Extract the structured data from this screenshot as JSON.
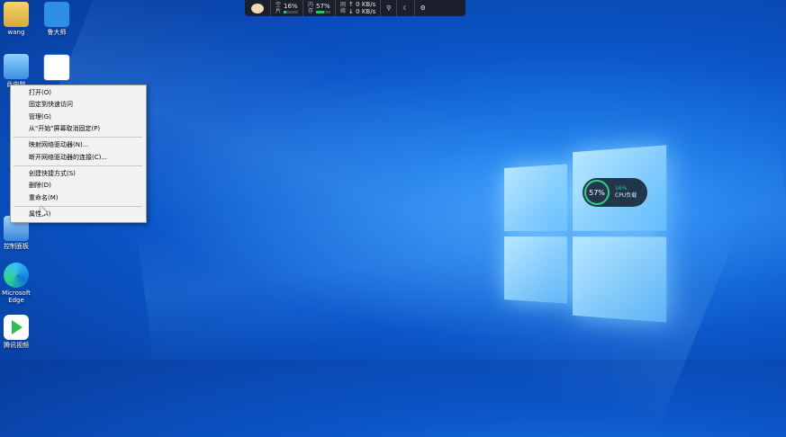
{
  "monitor": {
    "mem_key": "空",
    "mem_key2": "片",
    "mem_value": "16%",
    "cpu_key": "内",
    "cpu_key2": "存",
    "cpu_value": "57%",
    "net_key": "网",
    "net_key2": "络",
    "up_speed": "0 KB/s",
    "down_speed": "0 KB/s",
    "mem_fill": 0.16,
    "cpu_fill": 0.57
  },
  "desktop_icons": [
    {
      "label": "wang"
    },
    {
      "label": "鲁大师"
    },
    {
      "label": "此电脑"
    },
    {
      "label": "控制面板"
    },
    {
      "label": "Microsoft\nEdge"
    },
    {
      "label": "腾讯视频"
    }
  ],
  "context_menu": {
    "items": [
      "打开(O)",
      "固定到快速访问",
      "管理(G)",
      "从\"开始\"屏幕取消固定(P)",
      "映射网络驱动器(N)...",
      "断开网络驱动器的连接(C)...",
      "创建快捷方式(S)",
      "删除(D)",
      "重命名(M)",
      "属性(R)"
    ]
  },
  "cpu_widget": {
    "percent": "57%",
    "line1": "16%",
    "line2": "CPU负载"
  },
  "colors": {
    "accent_green": "#2fd18a",
    "desktop_blue": "#0b56c9"
  }
}
